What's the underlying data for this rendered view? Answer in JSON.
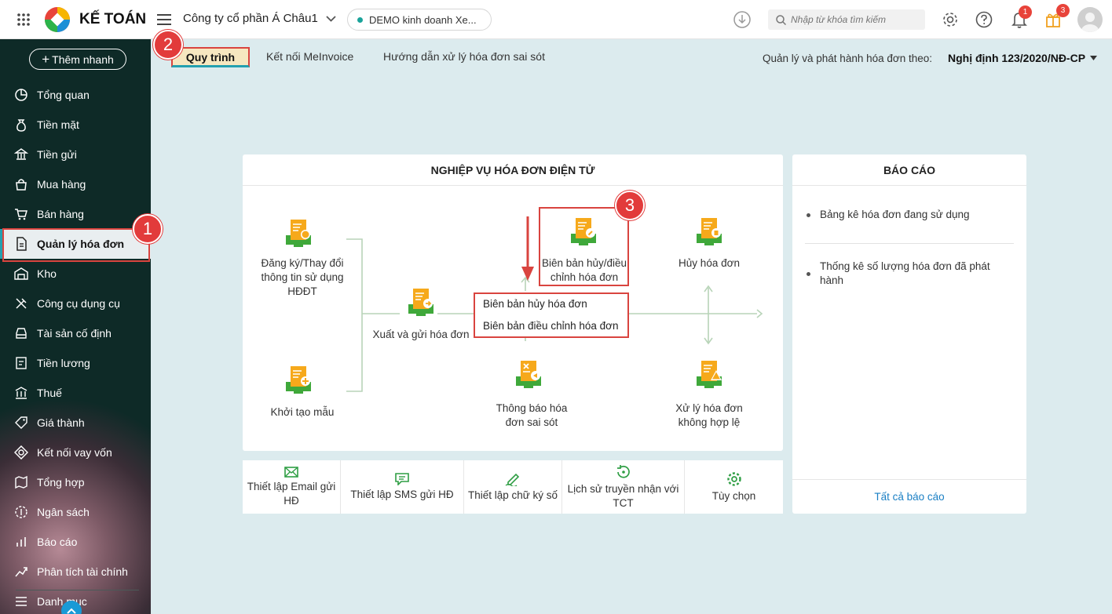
{
  "app": {
    "brand": "KẾ TOÁN",
    "company": "Công ty cổ phần Á Châu1",
    "demo_label": "DEMO kinh doanh Xe..."
  },
  "search": {
    "placeholder": "Nhập từ khóa tìm kiếm"
  },
  "notifications": {
    "bell_count": "1",
    "gift_count": "3"
  },
  "sidebar": {
    "quick_add": "Thêm nhanh",
    "items": [
      {
        "label": "Tổng quan",
        "icon": "pie-chart-icon"
      },
      {
        "label": "Tiền mặt",
        "icon": "money-bag-icon"
      },
      {
        "label": "Tiền gửi",
        "icon": "bank-icon"
      },
      {
        "label": "Mua hàng",
        "icon": "shopping-bag-icon"
      },
      {
        "label": "Bán hàng",
        "icon": "cart-icon"
      },
      {
        "label": "Quản lý hóa đơn",
        "icon": "invoice-icon"
      },
      {
        "label": "Kho",
        "icon": "warehouse-icon"
      },
      {
        "label": "Công cụ dụng cụ",
        "icon": "tools-icon"
      },
      {
        "label": "Tài sản cố định",
        "icon": "car-icon"
      },
      {
        "label": "Tiền lương",
        "icon": "payroll-icon"
      },
      {
        "label": "Thuế",
        "icon": "tax-icon"
      },
      {
        "label": "Giá thành",
        "icon": "price-tag-icon"
      },
      {
        "label": "Kết nối vay vốn",
        "icon": "loan-icon"
      },
      {
        "label": "Tổng hợp",
        "icon": "summary-icon"
      },
      {
        "label": "Ngân sách",
        "icon": "budget-icon"
      },
      {
        "label": "Báo cáo",
        "icon": "report-icon"
      },
      {
        "label": "Phân tích tài chính",
        "icon": "analytics-icon"
      },
      {
        "label": "Danh mục",
        "icon": "list-icon"
      }
    ]
  },
  "tabs": [
    {
      "label": "Quy trình",
      "active": true
    },
    {
      "label": "Kết nối MeInvoice"
    },
    {
      "label": "Hướng dẫn xử lý hóa đơn sai sót"
    }
  ],
  "decree": {
    "label": "Quản lý và phát hành hóa đơn theo:",
    "value": "Nghị định 123/2020/NĐ-CP"
  },
  "workflow": {
    "title": "NGHIỆP VỤ HÓA ĐƠN ĐIỆN TỬ",
    "nodes": {
      "register": "Đăng ký/Thay đổi thông tin sử dụng HĐĐT",
      "init_template": "Khởi tạo mẫu",
      "issue_send": "Xuất và gửi hóa đơn",
      "minutes": "Biên bản hủy/điều chỉnh hóa đơn",
      "cancel": "Hủy hóa đơn",
      "notify_error": "Thông báo hóa đơn sai sót",
      "handle_invalid": "Xử lý hóa đơn không hợp lệ"
    },
    "dropdown": [
      "Biên bản hủy hóa đơn",
      "Biên bản điều chỉnh hóa đơn"
    ]
  },
  "bottom_actions": [
    {
      "label": "Thiết lập Email gửi HĐ",
      "icon": "email-icon"
    },
    {
      "label": "Thiết lập SMS gửi HĐ",
      "icon": "sms-icon"
    },
    {
      "label": "Thiết lập chữ ký số",
      "icon": "signature-icon"
    },
    {
      "label": "Lịch sử truyền nhận với TCT",
      "icon": "history-icon"
    },
    {
      "label": "Tùy chọn",
      "icon": "gear-icon"
    }
  ],
  "reports": {
    "title": "BÁO CÁO",
    "items": [
      "Bảng kê hóa đơn đang sử dụng",
      "Thống kê số lượng hóa đơn đã phát hành"
    ],
    "all_link": "Tất cả báo cáo"
  },
  "callouts": [
    "1",
    "2",
    "3"
  ],
  "colors": {
    "accent": "#23a0b0",
    "sidebar": "#0e2a27",
    "content_bg": "#dcebee",
    "callout": "#e23b3b",
    "invoice_green": "#3fa83a",
    "invoice_orange": "#f6a91b"
  }
}
